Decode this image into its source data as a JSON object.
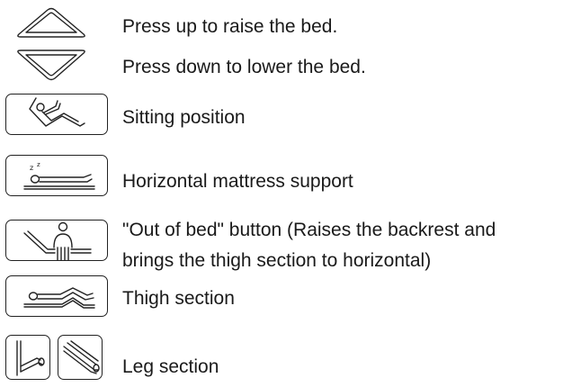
{
  "instructions": [
    {
      "id": "raise",
      "icon": "triangle-up-icon",
      "text": "Press up to raise the bed."
    },
    {
      "id": "lower",
      "icon": "triangle-down-icon",
      "text": "Press down to lower the bed."
    },
    {
      "id": "sitting",
      "icon": "sitting-position-icon",
      "text": "Sitting position"
    },
    {
      "id": "horizontal",
      "icon": "sleeping-person-icon",
      "text": "Horizontal mattress support"
    },
    {
      "id": "out-of-bed",
      "icon": "out-of-bed-icon",
      "text_line1": "\"Out of bed\" button (Raises the backrest and",
      "text_line2": "brings the thigh section to horizontal)"
    },
    {
      "id": "thigh",
      "icon": "thigh-section-icon",
      "text": "Thigh section"
    },
    {
      "id": "leg",
      "icon": "leg-section-icon",
      "text": "Leg section"
    }
  ],
  "colors": {
    "text": "#1a1a1a",
    "stroke": "#222222",
    "background": "#ffffff"
  }
}
